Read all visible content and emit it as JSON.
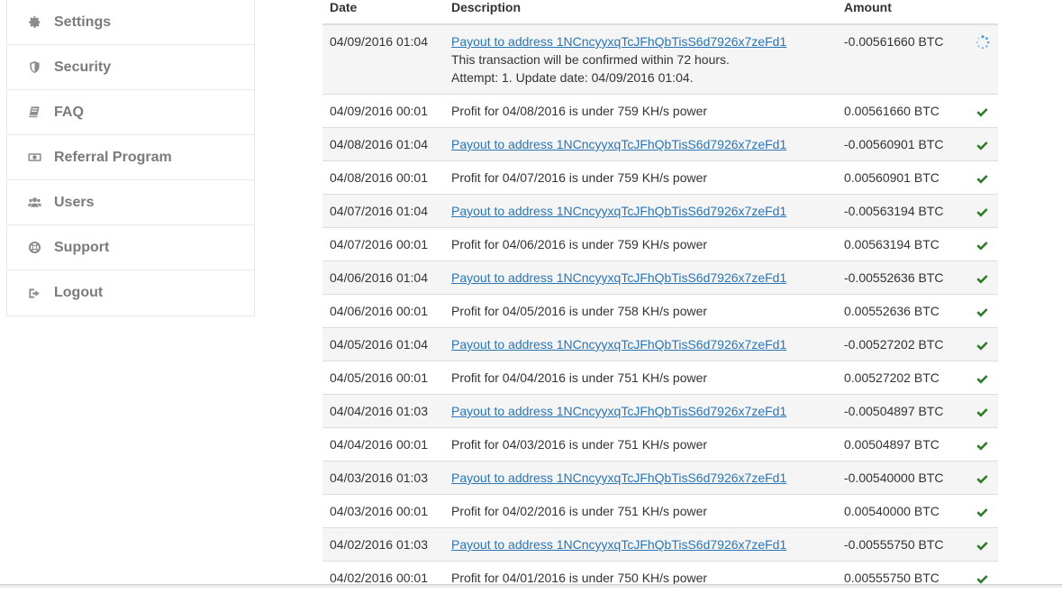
{
  "sidebar": {
    "items": [
      {
        "label": "Settings",
        "icon": "gear-icon"
      },
      {
        "label": "Security",
        "icon": "shield-icon"
      },
      {
        "label": "FAQ",
        "icon": "book-icon"
      },
      {
        "label": "Referral Program",
        "icon": "money-icon"
      },
      {
        "label": "Users",
        "icon": "users-icon"
      },
      {
        "label": "Support",
        "icon": "lifebuoy-icon"
      },
      {
        "label": "Logout",
        "icon": "sign-out-icon"
      }
    ]
  },
  "table": {
    "headers": {
      "date": "Date",
      "description": "Description",
      "amount": "Amount"
    },
    "pending": {
      "date": "04/09/2016 01:04",
      "link": "Payout to address 1NCncyyxqTcJFhQbTisS6d7926x7zeFd1",
      "note1": "This transaction will be confirmed within 72 hours.",
      "note2": "Attempt: 1. Update date: 04/09/2016 01:04.",
      "amount": "-0.00561660 BTC",
      "status": "spinner-icon"
    },
    "rows": [
      {
        "date": "04/09/2016 00:01",
        "description": "Profit for 04/08/2016 is under 759 KH/s power",
        "amount": "0.00561660 BTC",
        "is_link": false
      },
      {
        "date": "04/08/2016 01:04",
        "description": "Payout to address 1NCncyyxqTcJFhQbTisS6d7926x7zeFd1",
        "amount": "-0.00560901 BTC",
        "is_link": true
      },
      {
        "date": "04/08/2016 00:01",
        "description": "Profit for 04/07/2016 is under 759 KH/s power",
        "amount": "0.00560901 BTC",
        "is_link": false
      },
      {
        "date": "04/07/2016 01:04",
        "description": "Payout to address 1NCncyyxqTcJFhQbTisS6d7926x7zeFd1",
        "amount": "-0.00563194 BTC",
        "is_link": true
      },
      {
        "date": "04/07/2016 00:01",
        "description": "Profit for 04/06/2016 is under 759 KH/s power",
        "amount": "0.00563194 BTC",
        "is_link": false
      },
      {
        "date": "04/06/2016 01:04",
        "description": "Payout to address 1NCncyyxqTcJFhQbTisS6d7926x7zeFd1",
        "amount": "-0.00552636 BTC",
        "is_link": true
      },
      {
        "date": "04/06/2016 00:01",
        "description": "Profit for 04/05/2016 is under 758 KH/s power",
        "amount": "0.00552636 BTC",
        "is_link": false
      },
      {
        "date": "04/05/2016 01:04",
        "description": "Payout to address 1NCncyyxqTcJFhQbTisS6d7926x7zeFd1",
        "amount": "-0.00527202 BTC",
        "is_link": true
      },
      {
        "date": "04/05/2016 00:01",
        "description": "Profit for 04/04/2016 is under 751 KH/s power",
        "amount": "0.00527202 BTC",
        "is_link": false
      },
      {
        "date": "04/04/2016 01:03",
        "description": "Payout to address 1NCncyyxqTcJFhQbTisS6d7926x7zeFd1",
        "amount": "-0.00504897 BTC",
        "is_link": true
      },
      {
        "date": "04/04/2016 00:01",
        "description": "Profit for 04/03/2016 is under 751 KH/s power",
        "amount": "0.00504897 BTC",
        "is_link": false
      },
      {
        "date": "04/03/2016 01:03",
        "description": "Payout to address 1NCncyyxqTcJFhQbTisS6d7926x7zeFd1",
        "amount": "-0.00540000 BTC",
        "is_link": true
      },
      {
        "date": "04/03/2016 00:01",
        "description": "Profit for 04/02/2016 is under 751 KH/s power",
        "amount": "0.00540000 BTC",
        "is_link": false
      },
      {
        "date": "04/02/2016 01:03",
        "description": "Payout to address 1NCncyyxqTcJFhQbTisS6d7926x7zeFd1",
        "amount": "-0.00555750 BTC",
        "is_link": true
      },
      {
        "date": "04/02/2016 00:01",
        "description": "Profit for 04/01/2016 is under 750 KH/s power",
        "amount": "0.00555750 BTC",
        "is_link": false
      }
    ]
  },
  "colors": {
    "link": "#2a75b3",
    "success": "#2b7a26",
    "spinner": "#3a8fd6",
    "nav_text": "#7b7b7b"
  }
}
